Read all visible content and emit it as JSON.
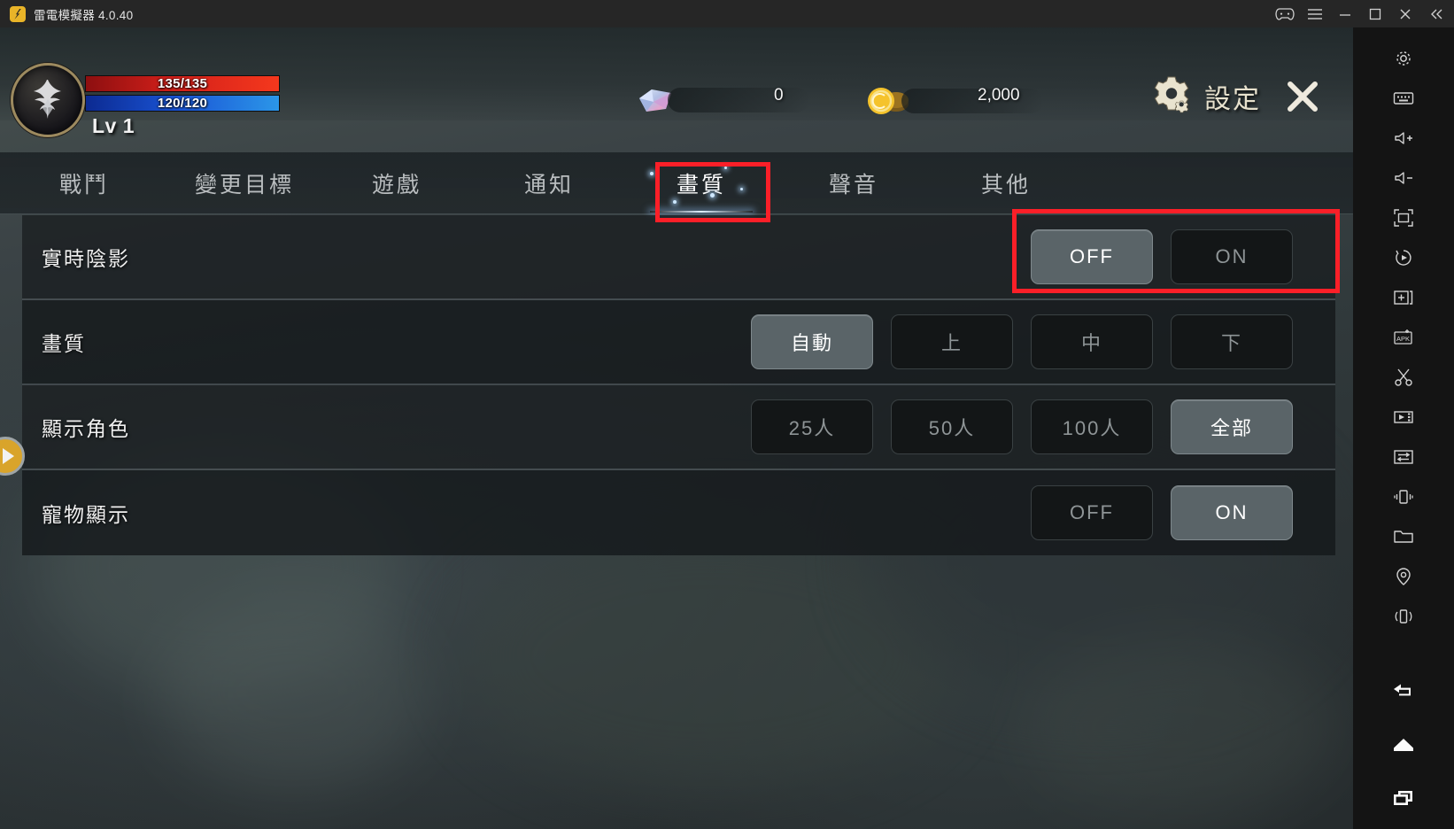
{
  "titlebar": {
    "app_title": "雷電模擬器 4.0.40",
    "buttons": [
      {
        "name": "gamepad-icon",
        "label": "gamepad"
      },
      {
        "name": "menu-icon",
        "label": "menu"
      },
      {
        "name": "minimize-icon",
        "label": "minimize"
      },
      {
        "name": "maximize-icon",
        "label": "maximize"
      },
      {
        "name": "close-icon",
        "label": "close"
      },
      {
        "name": "collapse-icon",
        "label": "collapse"
      }
    ]
  },
  "hud": {
    "hp": "135/135",
    "mp": "120/120",
    "level": "Lv 1",
    "gem_value": "0",
    "gold_value": "2,000",
    "settings_label": "設定"
  },
  "tabs": [
    {
      "label": "戰鬥",
      "active": false
    },
    {
      "label": "變更目標",
      "active": false
    },
    {
      "label": "遊戲",
      "active": false
    },
    {
      "label": "通知",
      "active": false
    },
    {
      "label": "畫質",
      "active": true
    },
    {
      "label": "聲音",
      "active": false
    },
    {
      "label": "其他",
      "active": false
    }
  ],
  "rows": [
    {
      "label": "實時陰影",
      "options": [
        {
          "text": "OFF",
          "selected": true
        },
        {
          "text": "ON",
          "selected": false
        }
      ]
    },
    {
      "label": "畫質",
      "options": [
        {
          "text": "自動",
          "selected": true
        },
        {
          "text": "上",
          "selected": false
        },
        {
          "text": "中",
          "selected": false
        },
        {
          "text": "下",
          "selected": false
        }
      ]
    },
    {
      "label": "顯示角色",
      "options": [
        {
          "text": "25人",
          "selected": false
        },
        {
          "text": "50人",
          "selected": false
        },
        {
          "text": "100人",
          "selected": false
        },
        {
          "text": "全部",
          "selected": true
        }
      ]
    },
    {
      "label": "寵物顯示",
      "options": [
        {
          "text": "OFF",
          "selected": false
        },
        {
          "text": "ON",
          "selected": true
        }
      ]
    }
  ],
  "annotations": {
    "color": "#fb1f28",
    "boxes": [
      "active-tab-highlight",
      "realtime-shadow-options-highlight"
    ]
  },
  "sidebar": {
    "items": [
      "settings-gear-icon",
      "keyboard-icon",
      "volume-up-icon",
      "volume-down-icon",
      "fullscreen-icon",
      "rotate-icon",
      "add-window-icon",
      "install-apk-icon",
      "scissors-icon",
      "record-video-icon",
      "file-transfer-icon",
      "shake-icon",
      "folder-icon",
      "location-icon",
      "vibrate-icon"
    ],
    "nav": [
      "back-icon",
      "home-icon",
      "recents-icon"
    ]
  },
  "colors": {
    "accent_red": "#fb1f28",
    "hp_red": "#d4201a",
    "mp_blue": "#1a55d6",
    "gold": "#d9a42b",
    "selected_button": "#5a6468"
  }
}
